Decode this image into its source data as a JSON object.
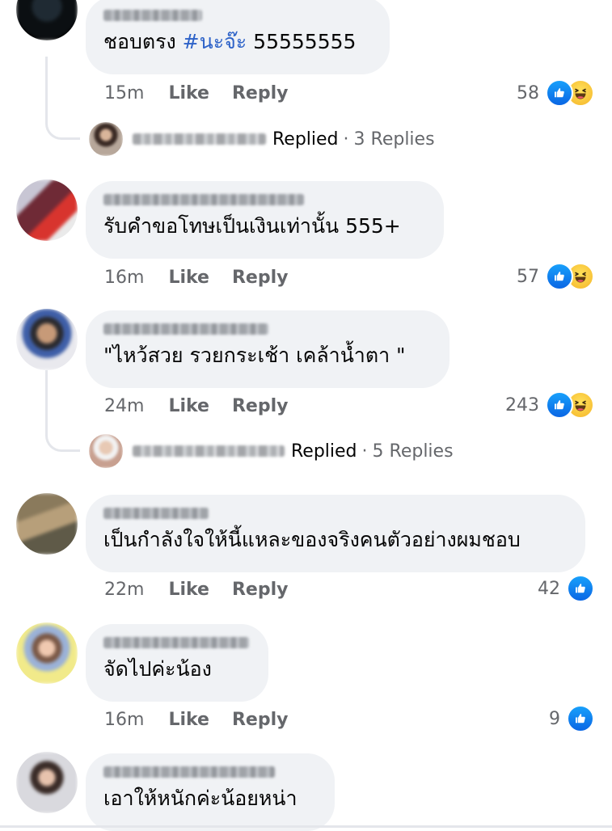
{
  "colors": {
    "like_blue": "#0a66e4",
    "hashtag": "#2d62c8",
    "bubble_bg": "#f0f2f5",
    "meta_gray": "#65676b"
  },
  "comments": [
    {
      "author": "",
      "text": "ชอบตรง ",
      "hashtag": "#นะจ๊ะ",
      "text_after": " 55555555",
      "time": "15m",
      "like_label": "Like",
      "reply_label": "Reply",
      "reaction_count": "58",
      "reactions": [
        "like-icon",
        "haha-icon"
      ],
      "replies": {
        "author": "",
        "label": "Replied",
        "dot": "·",
        "count": "3 Replies"
      }
    },
    {
      "author": "",
      "text": "รับคำขอโทษเป็นเงินเท่านั้น 555+",
      "time": "16m",
      "like_label": "Like",
      "reply_label": "Reply",
      "reaction_count": "57",
      "reactions": [
        "like-icon",
        "haha-icon"
      ]
    },
    {
      "author": "",
      "text": "\"ไหว้สวย รวยกระเช้า เคล้าน้ำตา \"",
      "time": "24m",
      "like_label": "Like",
      "reply_label": "Reply",
      "reaction_count": "243",
      "reactions": [
        "like-icon",
        "haha-icon"
      ],
      "replies": {
        "author": "",
        "label": "Replied",
        "dot": "·",
        "count": "5 Replies"
      }
    },
    {
      "author": "",
      "text": "เป็นกำลังใจให้นี้แหละของจริงคนตัวอย่างผมชอบ",
      "time": "22m",
      "like_label": "Like",
      "reply_label": "Reply",
      "reaction_count": "42",
      "reactions": [
        "like-icon"
      ]
    },
    {
      "author": "",
      "text": "จัดไปค่ะน้อง",
      "time": "16m",
      "like_label": "Like",
      "reply_label": "Reply",
      "reaction_count": "9",
      "reactions": [
        "like-icon"
      ]
    },
    {
      "author": "",
      "text": "เอาให้หนักค่ะน้อยหน่า"
    }
  ]
}
